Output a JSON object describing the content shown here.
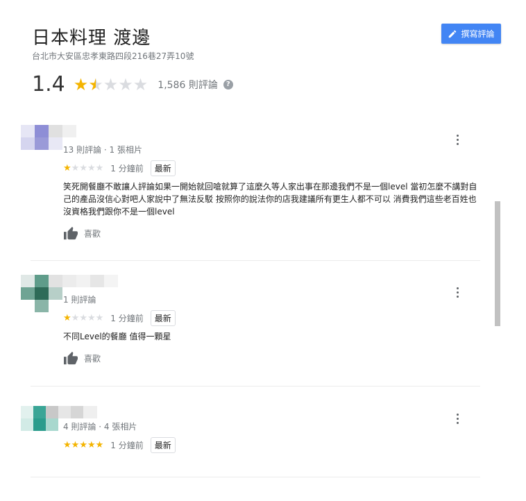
{
  "place": {
    "title": "日本料理 渡邊",
    "address": "台北市大安區忠孝東路四段216巷27弄10號",
    "write_review_label": "撰寫評論",
    "rating": "1.4",
    "rating_value": 1.4,
    "total_reviews": "1,586 則評論",
    "help_icon": "?"
  },
  "colors": {
    "accent": "#4285f4",
    "star": "#f4b400",
    "star_empty": "#dadce0"
  },
  "icons": {
    "write": "pencil-icon",
    "like": "thumbs-up-icon",
    "menu": "more-vert-icon",
    "help": "help-icon"
  },
  "reviews": [
    {
      "meta": "13 則評論 · 1 張相片",
      "stars": 1,
      "time": "1 分鐘前",
      "badge": "最新",
      "text": "笑死開餐廳不敢讓人評論如果一開始就回嗆就算了這麼久等人家出事在那邊我們不是一個level 當初怎麼不講對自己的產品沒信心對吧人家說中了無法反駁 按照你的說法你的店我建議所有更生人都不可以 消費我們這些老百姓也沒資格我們跟你不是一個level",
      "like_label": "喜歡"
    },
    {
      "meta": "1 則評論",
      "stars": 1,
      "time": "1 分鐘前",
      "badge": "最新",
      "text": "不同Level的餐廳 值得一顆星",
      "like_label": "喜歡"
    },
    {
      "meta": "4 則評論 · 4 張相片",
      "stars": 5,
      "time": "1 分鐘前",
      "badge": "最新",
      "text": "",
      "like_label": ""
    }
  ]
}
